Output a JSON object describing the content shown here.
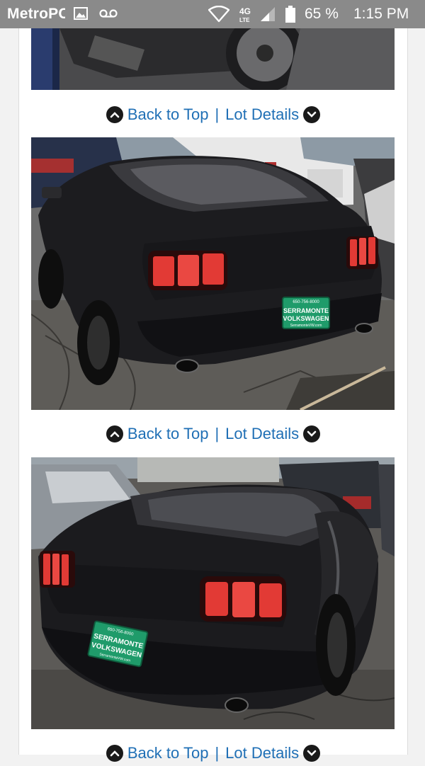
{
  "status_bar": {
    "carrier": "MetroPCS",
    "network": "4G LTE",
    "battery_percent": "65 %",
    "time": "1:15 PM"
  },
  "gallery": {
    "nav_rows": [
      {
        "back_to_top": "Back to Top",
        "separator": "|",
        "lot_details": "Lot Details"
      },
      {
        "back_to_top": "Back to Top",
        "separator": "|",
        "lot_details": "Lot Details"
      },
      {
        "back_to_top": "Back to Top",
        "separator": "|",
        "lot_details": "Lot Details"
      }
    ],
    "photos": [
      {
        "plate_line1": "",
        "plate_line2": ""
      },
      {
        "plate_top": "650-756-8000",
        "plate_line1": "SERRAMONTE",
        "plate_line2": "VOLKSWAGEN",
        "plate_bottom": "SerramonteVW.com"
      },
      {
        "plate_top": "650-756-8000",
        "plate_line1": "SERRAMONTE",
        "plate_line2": "VOLKSWAGEN",
        "plate_bottom": "SerramonteVW.com"
      }
    ]
  },
  "colors": {
    "link": "#1f6fb5",
    "status_bar": "#8a8a8a",
    "plate_green": "#1f9b6a"
  }
}
